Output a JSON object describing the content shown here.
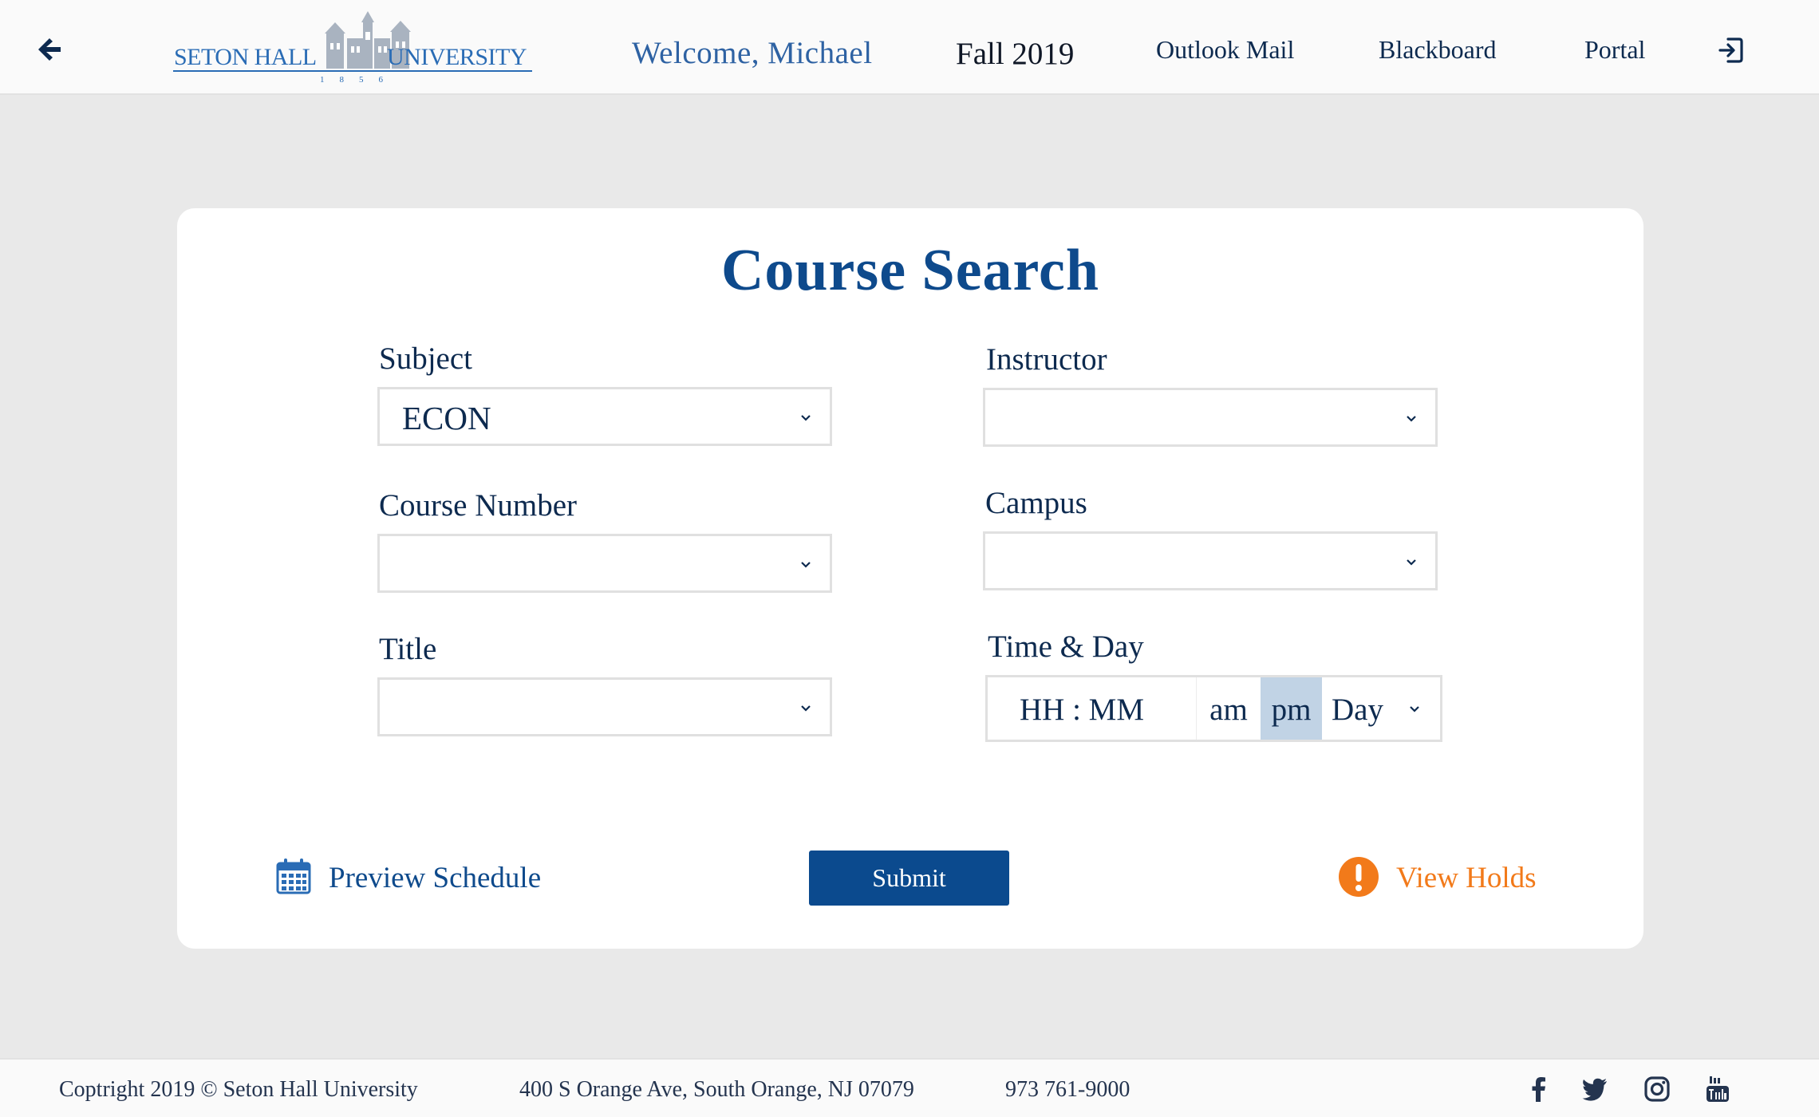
{
  "header": {
    "logo": {
      "left": "SETON HALL",
      "right": "UNIVERSITY",
      "year": "1856"
    },
    "welcome": "Welcome, Michael",
    "term": "Fall 2019",
    "links": [
      "Outlook Mail",
      "Blackboard",
      "Portal"
    ],
    "icons": {
      "back": "arrow-left-icon",
      "logout": "sign-in-icon"
    }
  },
  "search": {
    "title": "Course Search",
    "fields": {
      "subject": {
        "label": "Subject",
        "value": "ECON"
      },
      "instructor": {
        "label": "Instructor",
        "value": ""
      },
      "course_number": {
        "label": "Course Number",
        "value": ""
      },
      "campus": {
        "label": "Campus",
        "value": ""
      },
      "title": {
        "label": "Title",
        "value": ""
      },
      "time_day": {
        "label": "Time & Day",
        "time_placeholder": "HH : MM",
        "am": "am",
        "pm": "pm",
        "selected_meridiem": "pm",
        "day": "Day"
      }
    },
    "preview_schedule": "Preview Schedule",
    "submit": "Submit",
    "view_holds": "View Holds"
  },
  "footer": {
    "copyright": "Coptright 2019  ©  Seton Hall University",
    "address": "400 S Orange Ave, South Orange, NJ 07079",
    "phone": "973 761-9000",
    "social": [
      "facebook-icon",
      "twitter-icon",
      "instagram-icon",
      "youtube-icon"
    ]
  },
  "colors": {
    "brand_blue": "#0b4a8e",
    "link_blue": "#2e62a3",
    "holds_orange": "#f27a1a",
    "pm_highlight": "#c1d3e5",
    "background": "#e9e9e9"
  }
}
